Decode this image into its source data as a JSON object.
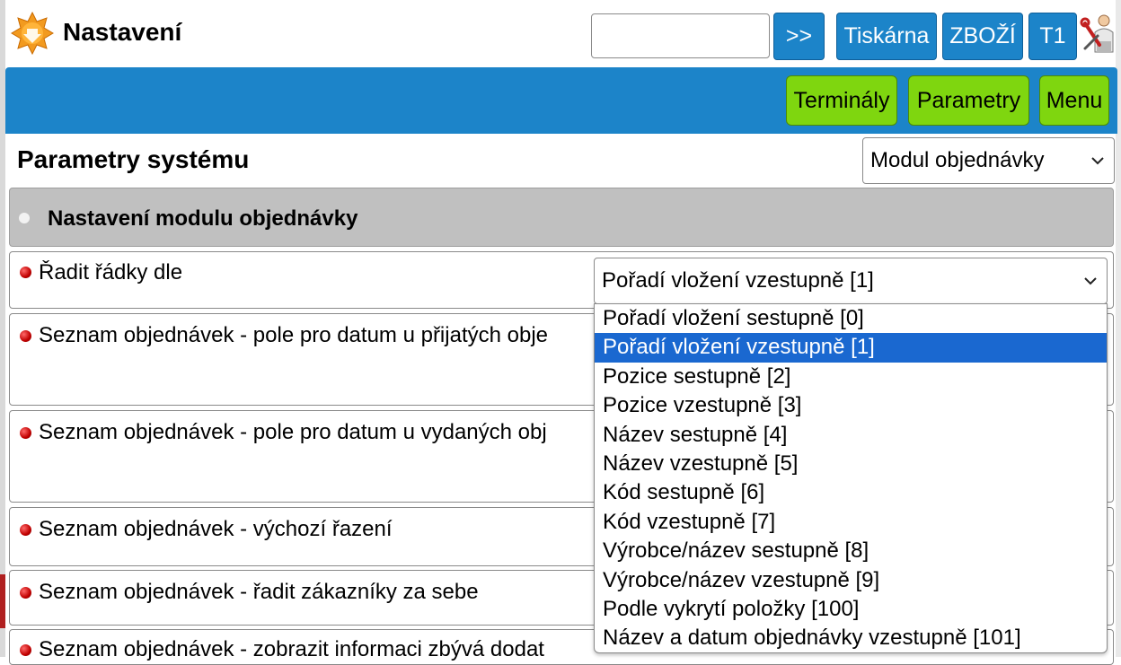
{
  "header": {
    "title": "Nastavení",
    "search_value": "",
    "go_label": ">>",
    "buttons": [
      "Tiskárna",
      "ZBOŽÍ",
      "T1"
    ]
  },
  "nav": {
    "buttons": [
      "Terminály",
      "Parametry",
      "Menu"
    ]
  },
  "page": {
    "title": "Parametry systému",
    "module_select": "Modul objednávky"
  },
  "section": {
    "title": "Nastavení modulu objednávky"
  },
  "params": [
    "Řadit řádky dle",
    "Seznam objednávek - pole pro datum u přijatých obje",
    "Seznam objednávek - pole pro datum u vydaných obj",
    "Seznam objednávek - výchozí řazení",
    "Seznam objednávek - řadit zákazníky za sebe",
    "Seznam objednávek - zobrazit informaci zbývá dodat"
  ],
  "sort_select": {
    "value": "Pořadí vložení vzestupně [1]",
    "options": [
      "Pořadí vložení sestupně [0]",
      "Pořadí vložení vzestupně [1]",
      "Pozice sestupně [2]",
      "Pozice vzestupně [3]",
      "Název sestupně [4]",
      "Název vzestupně [5]",
      "Kód sestupně [6]",
      "Kód vzestupně [7]",
      "Výrobce/název sestupně [8]",
      "Výrobce/název vzestupně [9]",
      "Podle vykrytí položky [100]",
      "Název a datum objednávky vzestupně [101]"
    ],
    "selected_index": 1
  },
  "colors": {
    "blue": "#1c84c9",
    "green": "#7fd60f",
    "selected": "#1a68d0",
    "section_bg": "#c0c0c0"
  },
  "icons": [
    "app-logo-icon",
    "tools-icon",
    "chevron-down-icon",
    "bullet-icon"
  ]
}
